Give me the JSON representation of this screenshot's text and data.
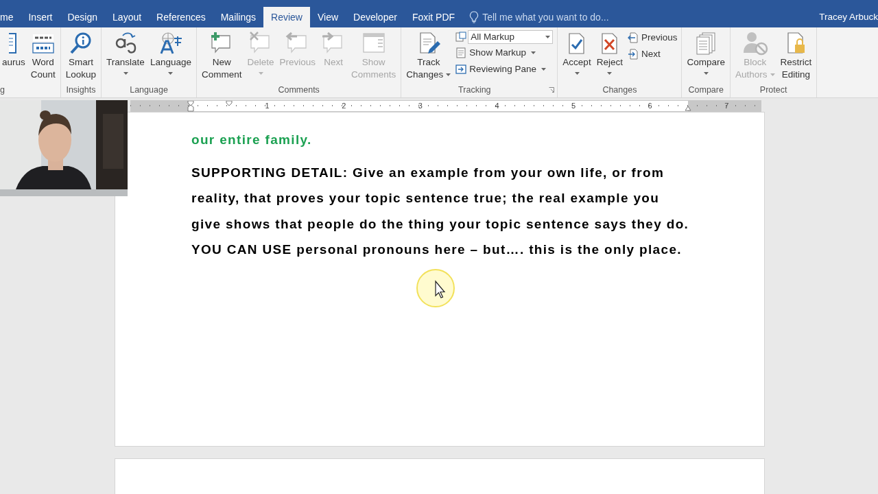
{
  "tabs": [
    {
      "label": "me",
      "selected": false
    },
    {
      "label": "Insert",
      "selected": false
    },
    {
      "label": "Design",
      "selected": false
    },
    {
      "label": "Layout",
      "selected": false
    },
    {
      "label": "References",
      "selected": false
    },
    {
      "label": "Mailings",
      "selected": false
    },
    {
      "label": "Review",
      "selected": true
    },
    {
      "label": "View",
      "selected": false
    },
    {
      "label": "Developer",
      "selected": false
    },
    {
      "label": "Foxit PDF",
      "selected": false
    }
  ],
  "tell_me": {
    "placeholder": "Tell me what you want to do..."
  },
  "user": "Tracey Arbuck",
  "ribbon_groups": [
    {
      "label": "g",
      "items": [
        {
          "kind": "large",
          "lines": [
            "aurus"
          ],
          "disabled": false,
          "menu": false
        },
        {
          "kind": "large",
          "lines": [
            "Word",
            "Count"
          ],
          "disabled": false,
          "menu": false
        }
      ]
    },
    {
      "label": "Insights",
      "launcher": false,
      "items": [
        {
          "kind": "large",
          "lines": [
            "Smart",
            "Lookup"
          ],
          "disabled": false,
          "menu": false
        }
      ]
    },
    {
      "label": "Language",
      "launcher": false,
      "items": [
        {
          "kind": "large",
          "lines": [
            "Translate"
          ],
          "disabled": false,
          "menu": true
        },
        {
          "kind": "large",
          "lines": [
            "Language"
          ],
          "disabled": false,
          "menu": true
        }
      ]
    },
    {
      "label": "Comments",
      "launcher": false,
      "items": [
        {
          "kind": "large",
          "lines": [
            "New",
            "Comment"
          ],
          "disabled": false,
          "menu": false
        },
        {
          "kind": "large",
          "lines": [
            "Delete"
          ],
          "disabled": true,
          "menu": true
        },
        {
          "kind": "large",
          "lines": [
            "Previous"
          ],
          "disabled": true,
          "menu": false
        },
        {
          "kind": "large",
          "lines": [
            "Next"
          ],
          "disabled": true,
          "menu": false
        },
        {
          "kind": "large",
          "lines": [
            "Show",
            "Comments"
          ],
          "disabled": true,
          "menu": false
        }
      ]
    },
    {
      "label": "Tracking",
      "launcher": true,
      "items": [
        {
          "kind": "large",
          "lines": [
            "Track",
            "Changes"
          ],
          "disabled": false,
          "menu": true
        },
        {
          "kind": "stack",
          "items": [
            {
              "kind": "select",
              "value": "All Markup"
            },
            {
              "kind": "small",
              "label": "Show Markup",
              "menu": true
            },
            {
              "kind": "small",
              "label": "Reviewing Pane",
              "menu": true
            }
          ]
        }
      ]
    },
    {
      "label": "Changes",
      "launcher": false,
      "items": [
        {
          "kind": "large",
          "lines": [
            "Accept"
          ],
          "disabled": false,
          "menu": true
        },
        {
          "kind": "large",
          "lines": [
            "Reject"
          ],
          "disabled": false,
          "menu": true
        },
        {
          "kind": "stack",
          "items": [
            {
              "kind": "small",
              "label": "Previous",
              "menu": false
            },
            {
              "kind": "small",
              "label": "Next",
              "menu": false
            }
          ]
        }
      ]
    },
    {
      "label": "Compare",
      "launcher": false,
      "items": [
        {
          "kind": "large",
          "lines": [
            "Compare"
          ],
          "disabled": false,
          "menu": true
        }
      ]
    },
    {
      "label": "Protect",
      "launcher": false,
      "items": [
        {
          "kind": "large",
          "lines": [
            "Block",
            "Authors"
          ],
          "disabled": true,
          "menu": true
        },
        {
          "kind": "large",
          "lines": [
            "Restrict",
            "Editing"
          ],
          "disabled": false,
          "menu": false
        }
      ]
    }
  ],
  "ruler": {
    "numbers": [
      "1",
      "2",
      "3",
      "4",
      "5",
      "6",
      "7"
    ]
  },
  "document": {
    "paragraphs": [
      {
        "kind": "topic",
        "lines": [
          "our entire family."
        ]
      },
      {
        "kind": "detail",
        "lines": [
          "SUPPORTING DETAIL: Give an example from your own life, or from",
          "reality, that proves your topic sentence true; the real example you",
          "give shows that people do the thing your topic sentence says they do.",
          "YOU CAN USE personal pronouns here – but…. this is the only place."
        ]
      }
    ]
  }
}
